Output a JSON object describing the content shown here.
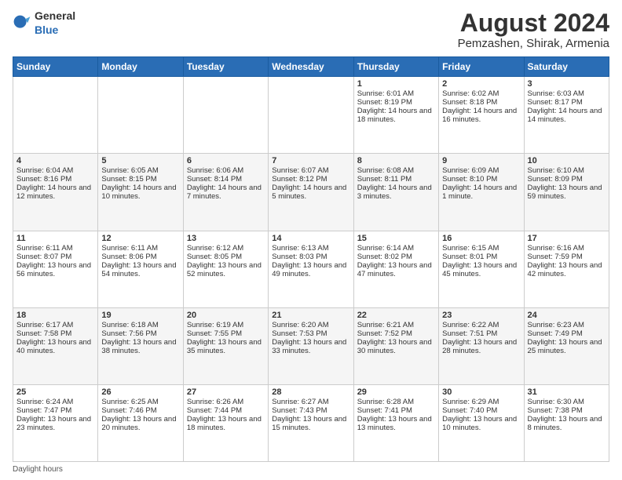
{
  "header": {
    "logo_general": "General",
    "logo_blue": "Blue",
    "month_year": "August 2024",
    "location": "Pemzashen, Shirak, Armenia"
  },
  "footer": {
    "note": "Daylight hours"
  },
  "days_of_week": [
    "Sunday",
    "Monday",
    "Tuesday",
    "Wednesday",
    "Thursday",
    "Friday",
    "Saturday"
  ],
  "weeks": [
    [
      {
        "day": "",
        "content": ""
      },
      {
        "day": "",
        "content": ""
      },
      {
        "day": "",
        "content": ""
      },
      {
        "day": "",
        "content": ""
      },
      {
        "day": "1",
        "content": "Sunrise: 6:01 AM\nSunset: 8:19 PM\nDaylight: 14 hours and 18 minutes."
      },
      {
        "day": "2",
        "content": "Sunrise: 6:02 AM\nSunset: 8:18 PM\nDaylight: 14 hours and 16 minutes."
      },
      {
        "day": "3",
        "content": "Sunrise: 6:03 AM\nSunset: 8:17 PM\nDaylight: 14 hours and 14 minutes."
      }
    ],
    [
      {
        "day": "4",
        "content": "Sunrise: 6:04 AM\nSunset: 8:16 PM\nDaylight: 14 hours and 12 minutes."
      },
      {
        "day": "5",
        "content": "Sunrise: 6:05 AM\nSunset: 8:15 PM\nDaylight: 14 hours and 10 minutes."
      },
      {
        "day": "6",
        "content": "Sunrise: 6:06 AM\nSunset: 8:14 PM\nDaylight: 14 hours and 7 minutes."
      },
      {
        "day": "7",
        "content": "Sunrise: 6:07 AM\nSunset: 8:12 PM\nDaylight: 14 hours and 5 minutes."
      },
      {
        "day": "8",
        "content": "Sunrise: 6:08 AM\nSunset: 8:11 PM\nDaylight: 14 hours and 3 minutes."
      },
      {
        "day": "9",
        "content": "Sunrise: 6:09 AM\nSunset: 8:10 PM\nDaylight: 14 hours and 1 minute."
      },
      {
        "day": "10",
        "content": "Sunrise: 6:10 AM\nSunset: 8:09 PM\nDaylight: 13 hours and 59 minutes."
      }
    ],
    [
      {
        "day": "11",
        "content": "Sunrise: 6:11 AM\nSunset: 8:07 PM\nDaylight: 13 hours and 56 minutes."
      },
      {
        "day": "12",
        "content": "Sunrise: 6:11 AM\nSunset: 8:06 PM\nDaylight: 13 hours and 54 minutes."
      },
      {
        "day": "13",
        "content": "Sunrise: 6:12 AM\nSunset: 8:05 PM\nDaylight: 13 hours and 52 minutes."
      },
      {
        "day": "14",
        "content": "Sunrise: 6:13 AM\nSunset: 8:03 PM\nDaylight: 13 hours and 49 minutes."
      },
      {
        "day": "15",
        "content": "Sunrise: 6:14 AM\nSunset: 8:02 PM\nDaylight: 13 hours and 47 minutes."
      },
      {
        "day": "16",
        "content": "Sunrise: 6:15 AM\nSunset: 8:01 PM\nDaylight: 13 hours and 45 minutes."
      },
      {
        "day": "17",
        "content": "Sunrise: 6:16 AM\nSunset: 7:59 PM\nDaylight: 13 hours and 42 minutes."
      }
    ],
    [
      {
        "day": "18",
        "content": "Sunrise: 6:17 AM\nSunset: 7:58 PM\nDaylight: 13 hours and 40 minutes."
      },
      {
        "day": "19",
        "content": "Sunrise: 6:18 AM\nSunset: 7:56 PM\nDaylight: 13 hours and 38 minutes."
      },
      {
        "day": "20",
        "content": "Sunrise: 6:19 AM\nSunset: 7:55 PM\nDaylight: 13 hours and 35 minutes."
      },
      {
        "day": "21",
        "content": "Sunrise: 6:20 AM\nSunset: 7:53 PM\nDaylight: 13 hours and 33 minutes."
      },
      {
        "day": "22",
        "content": "Sunrise: 6:21 AM\nSunset: 7:52 PM\nDaylight: 13 hours and 30 minutes."
      },
      {
        "day": "23",
        "content": "Sunrise: 6:22 AM\nSunset: 7:51 PM\nDaylight: 13 hours and 28 minutes."
      },
      {
        "day": "24",
        "content": "Sunrise: 6:23 AM\nSunset: 7:49 PM\nDaylight: 13 hours and 25 minutes."
      }
    ],
    [
      {
        "day": "25",
        "content": "Sunrise: 6:24 AM\nSunset: 7:47 PM\nDaylight: 13 hours and 23 minutes."
      },
      {
        "day": "26",
        "content": "Sunrise: 6:25 AM\nSunset: 7:46 PM\nDaylight: 13 hours and 20 minutes."
      },
      {
        "day": "27",
        "content": "Sunrise: 6:26 AM\nSunset: 7:44 PM\nDaylight: 13 hours and 18 minutes."
      },
      {
        "day": "28",
        "content": "Sunrise: 6:27 AM\nSunset: 7:43 PM\nDaylight: 13 hours and 15 minutes."
      },
      {
        "day": "29",
        "content": "Sunrise: 6:28 AM\nSunset: 7:41 PM\nDaylight: 13 hours and 13 minutes."
      },
      {
        "day": "30",
        "content": "Sunrise: 6:29 AM\nSunset: 7:40 PM\nDaylight: 13 hours and 10 minutes."
      },
      {
        "day": "31",
        "content": "Sunrise: 6:30 AM\nSunset: 7:38 PM\nDaylight: 13 hours and 8 minutes."
      }
    ]
  ]
}
